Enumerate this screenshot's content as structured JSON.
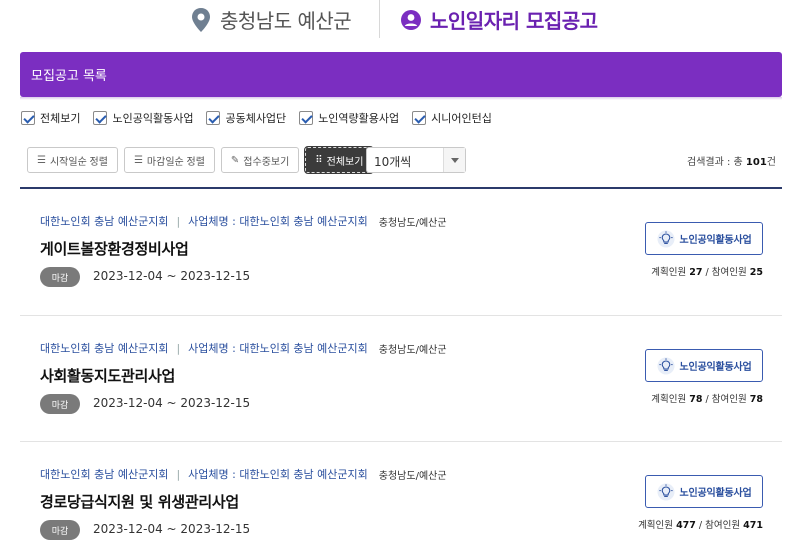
{
  "header": {
    "region": "충청남도 예산군",
    "title": "노인일자리 모집공고"
  },
  "section_title": "모집공고 목록",
  "filters": [
    {
      "label": "전체보기",
      "checked": true
    },
    {
      "label": "노인공익활동사업",
      "checked": true
    },
    {
      "label": "공동체사업단",
      "checked": true
    },
    {
      "label": "노인역량활용사업",
      "checked": true
    },
    {
      "label": "시니어인턴십",
      "checked": true
    }
  ],
  "toolbar": {
    "sort_start": "시작일순 정렬",
    "sort_end": "마감일순 정렬",
    "receiving": "접수중보기",
    "view_all": "전체보기",
    "per_page": "10개씩"
  },
  "result": {
    "prefix": "검색결과 : 총",
    "count": "101",
    "suffix": "건"
  },
  "items": [
    {
      "org": "대한노인회 충남 예산군지회",
      "biz_label": "사업체명 : 대한노인회 충남 예산군지회",
      "location": "충청남도/예산군",
      "title": "게이트볼장환경정비사업",
      "status": "마감",
      "period": "2023-12-04 ~ 2023-12-15",
      "category": "노인공익활동사업",
      "plan_label": "계획인원",
      "plan": "27",
      "join_label": "참여인원",
      "join": "25"
    },
    {
      "org": "대한노인회 충남 예산군지회",
      "biz_label": "사업체명 : 대한노인회 충남 예산군지회",
      "location": "충청남도/예산군",
      "title": "사회활동지도관리사업",
      "status": "마감",
      "period": "2023-12-04 ~ 2023-12-15",
      "category": "노인공익활동사업",
      "plan_label": "계획인원",
      "plan": "78",
      "join_label": "참여인원",
      "join": "78"
    },
    {
      "org": "대한노인회 충남 예산군지회",
      "biz_label": "사업체명 : 대한노인회 충남 예산군지회",
      "location": "충청남도/예산군",
      "title": "경로당급식지원 및 위생관리사업",
      "status": "마감",
      "period": "2023-12-04 ~ 2023-12-15",
      "category": "노인공익활동사업",
      "plan_label": "계획인원",
      "plan": "477",
      "join_label": "참여인원",
      "join": "471"
    }
  ],
  "colors": {
    "brand": "#7b2ec1",
    "link": "#2a4f9e",
    "status_closed": "#7a7a7a"
  },
  "icons": [
    "location-pin-icon",
    "user-circle-icon",
    "list-icon",
    "pencil-icon",
    "grid-icon",
    "lightbulb-icon"
  ]
}
